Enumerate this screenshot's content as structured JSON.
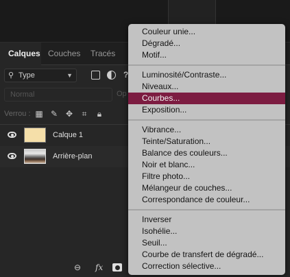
{
  "panel": {
    "tabs": [
      {
        "label": "Calques"
      },
      {
        "label": "Couches"
      },
      {
        "label": "Tracés"
      }
    ],
    "filter": {
      "label": "Type"
    },
    "blend_mode": "Normal",
    "opacity_label": "Op",
    "lock_label": "Verrou :",
    "layers": [
      {
        "name": "Calque 1",
        "visible": true,
        "thumb": "solid",
        "color": "#f5dfa9"
      },
      {
        "name": "Arrière-plan",
        "visible": true,
        "thumb": "photo"
      }
    ],
    "bottom_icons": {
      "fx": "fx",
      "link_icon": "link-icon",
      "mask_icon": "mask-icon"
    }
  },
  "adjustment_menu": {
    "highlight_color": "#7c1c41",
    "groups": [
      [
        "Couleur unie...",
        "Dégradé...",
        "Motif..."
      ],
      [
        "Luminosité/Contraste...",
        "Niveaux...",
        "Courbes...",
        "Exposition..."
      ],
      [
        "Vibrance...",
        "Teinte/Saturation...",
        "Balance des couleurs...",
        "Noir et blanc...",
        "Filtre photo...",
        "Mélangeur de couches...",
        "Correspondance de couleur..."
      ],
      [
        "Inverser",
        "Isohélie...",
        "Seuil...",
        "Courbe de transfert de dégradé...",
        "Correction sélective..."
      ]
    ],
    "highlighted": "Courbes..."
  }
}
